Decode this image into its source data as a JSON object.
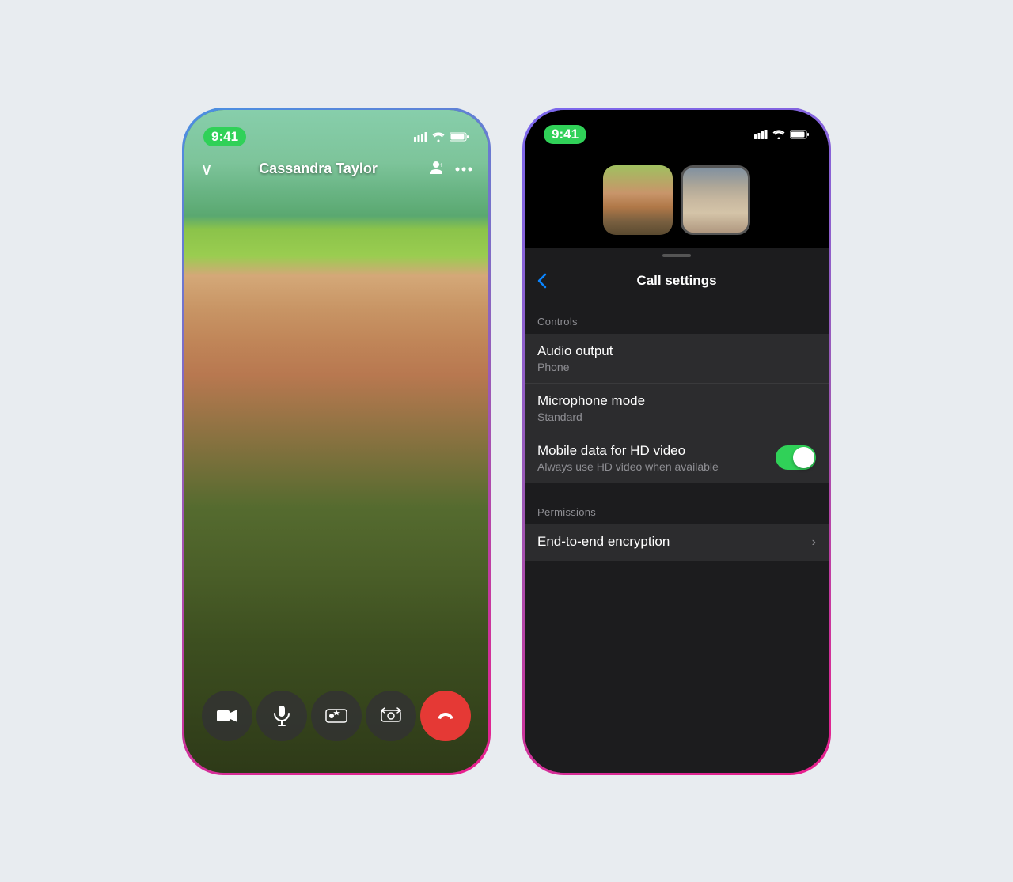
{
  "background": "#e8ecf0",
  "left_phone": {
    "status_time": "9:41",
    "caller_name": "Cassandra Taylor",
    "controls": [
      {
        "icon": "video-icon",
        "label": "Video"
      },
      {
        "icon": "mic-icon",
        "label": "Microphone"
      },
      {
        "icon": "effects-icon",
        "label": "Effects"
      },
      {
        "icon": "flip-icon",
        "label": "Flip"
      },
      {
        "icon": "end-call-icon",
        "label": "End Call"
      }
    ]
  },
  "right_phone": {
    "status_time": "9:41",
    "header_title": "Call settings",
    "back_label": "‹",
    "drag_handle": true,
    "sections": [
      {
        "header": "Controls",
        "rows": [
          {
            "title": "Audio output",
            "subtitle": "Phone",
            "control_type": "none"
          },
          {
            "title": "Microphone mode",
            "subtitle": "Standard",
            "control_type": "none"
          },
          {
            "title": "Mobile data for HD video",
            "subtitle": "Always use HD video when available",
            "control_type": "toggle",
            "toggle_on": true
          }
        ]
      },
      {
        "header": "Permissions",
        "rows": [
          {
            "title": "End-to-end encryption",
            "subtitle": "",
            "control_type": "chevron"
          }
        ]
      }
    ]
  }
}
